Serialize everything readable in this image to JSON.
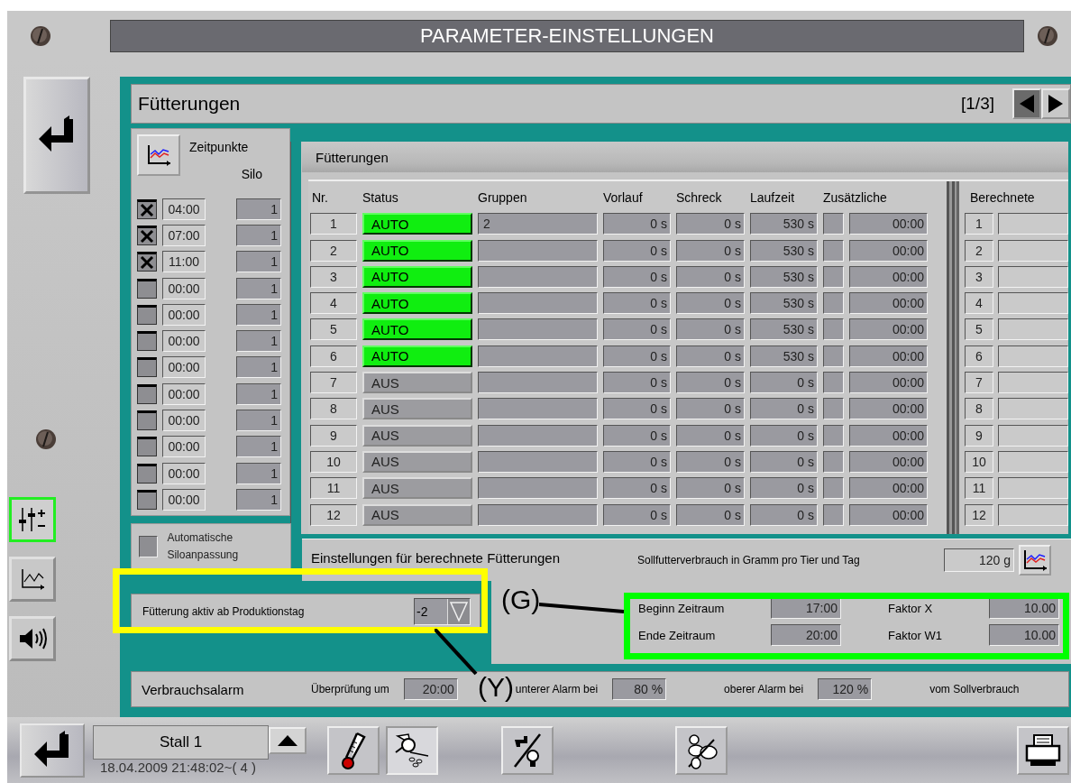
{
  "window": {
    "title": "PARAMETER-EINSTELLUNGEN"
  },
  "page": {
    "title": "Fütterungen",
    "pager": "[1/3]"
  },
  "sidebar": [
    {
      "kind": "settings",
      "selected": true
    },
    {
      "kind": "chart",
      "selected": false
    },
    {
      "kind": "sound",
      "selected": false
    }
  ],
  "zeitpunkte": {
    "label": "Zeitpunkte",
    "silo_label": "Silo",
    "rows": [
      {
        "time": "04:00",
        "silo": "1",
        "checked": true
      },
      {
        "time": "07:00",
        "silo": "1",
        "checked": true
      },
      {
        "time": "11:00",
        "silo": "1",
        "checked": true
      },
      {
        "time": "00:00",
        "silo": "1",
        "checked": false
      },
      {
        "time": "00:00",
        "silo": "1",
        "checked": false
      },
      {
        "time": "00:00",
        "silo": "1",
        "checked": false
      },
      {
        "time": "00:00",
        "silo": "1",
        "checked": false
      },
      {
        "time": "00:00",
        "silo": "1",
        "checked": false
      },
      {
        "time": "00:00",
        "silo": "1",
        "checked": false
      },
      {
        "time": "00:00",
        "silo": "1",
        "checked": false
      },
      {
        "time": "00:00",
        "silo": "1",
        "checked": false
      },
      {
        "time": "00:00",
        "silo": "1",
        "checked": false
      }
    ]
  },
  "auto_silo": {
    "label": "Automatische Siloanpassung",
    "checked": false
  },
  "feedings": {
    "title": "Fütterungen",
    "columns": [
      "Nr.",
      "Status",
      "Gruppen",
      "Vorlauf",
      "Schreck",
      "Laufzeit",
      "Zusätzliche"
    ],
    "rows": [
      {
        "nr": "1",
        "status": "AUTO",
        "on": true,
        "gruppen": "2",
        "vorlauf": "0 s",
        "schreck": "0 s",
        "laufzeit": "530 s",
        "extra_checked": false,
        "extra_time": "00:00"
      },
      {
        "nr": "2",
        "status": "AUTO",
        "on": true,
        "gruppen": "",
        "vorlauf": "0 s",
        "schreck": "0 s",
        "laufzeit": "530 s",
        "extra_checked": false,
        "extra_time": "00:00"
      },
      {
        "nr": "3",
        "status": "AUTO",
        "on": true,
        "gruppen": "",
        "vorlauf": "0 s",
        "schreck": "0 s",
        "laufzeit": "530 s",
        "extra_checked": false,
        "extra_time": "00:00"
      },
      {
        "nr": "4",
        "status": "AUTO",
        "on": true,
        "gruppen": "",
        "vorlauf": "0 s",
        "schreck": "0 s",
        "laufzeit": "530 s",
        "extra_checked": false,
        "extra_time": "00:00"
      },
      {
        "nr": "5",
        "status": "AUTO",
        "on": true,
        "gruppen": "",
        "vorlauf": "0 s",
        "schreck": "0 s",
        "laufzeit": "530 s",
        "extra_checked": false,
        "extra_time": "00:00"
      },
      {
        "nr": "6",
        "status": "AUTO",
        "on": true,
        "gruppen": "",
        "vorlauf": "0 s",
        "schreck": "0 s",
        "laufzeit": "530 s",
        "extra_checked": false,
        "extra_time": "00:00"
      },
      {
        "nr": "7",
        "status": "AUS",
        "on": false,
        "gruppen": "",
        "vorlauf": "0 s",
        "schreck": "0 s",
        "laufzeit": "0 s",
        "extra_checked": false,
        "extra_time": "00:00"
      },
      {
        "nr": "8",
        "status": "AUS",
        "on": false,
        "gruppen": "",
        "vorlauf": "0 s",
        "schreck": "0 s",
        "laufzeit": "0 s",
        "extra_checked": false,
        "extra_time": "00:00"
      },
      {
        "nr": "9",
        "status": "AUS",
        "on": false,
        "gruppen": "",
        "vorlauf": "0 s",
        "schreck": "0 s",
        "laufzeit": "0 s",
        "extra_checked": false,
        "extra_time": "00:00"
      },
      {
        "nr": "10",
        "status": "AUS",
        "on": false,
        "gruppen": "",
        "vorlauf": "0 s",
        "schreck": "0 s",
        "laufzeit": "0 s",
        "extra_checked": false,
        "extra_time": "00:00"
      },
      {
        "nr": "11",
        "status": "AUS",
        "on": false,
        "gruppen": "",
        "vorlauf": "0 s",
        "schreck": "0 s",
        "laufzeit": "0 s",
        "extra_checked": false,
        "extra_time": "00:00"
      },
      {
        "nr": "12",
        "status": "AUS",
        "on": false,
        "gruppen": "",
        "vorlauf": "0 s",
        "schreck": "0 s",
        "laufzeit": "0 s",
        "extra_checked": false,
        "extra_time": "00:00"
      }
    ]
  },
  "berechnete": {
    "title": "Berechnete",
    "rows": [
      "1",
      "2",
      "3",
      "4",
      "5",
      "6",
      "7",
      "8",
      "9",
      "10",
      "11",
      "12"
    ]
  },
  "production_day": {
    "label": "Fütterung aktiv ab Produktionstag",
    "value": "-2"
  },
  "calculated_settings": {
    "title": "Einstellungen für berechnete Fütterungen",
    "target_label": "Sollfutterverbrauch in Gramm pro Tier und Tag",
    "target_value": "120 g",
    "fields": [
      {
        "label": "Beginn Zeitraum",
        "value": "17:00"
      },
      {
        "label": "Faktor X",
        "value": "10.00"
      },
      {
        "label": "Ende Zeitraum",
        "value": "20:00"
      },
      {
        "label": "Faktor W1",
        "value": "10.00"
      }
    ]
  },
  "alarm": {
    "title": "Verbrauchsalarm",
    "items": [
      {
        "label": "Überprüfung um",
        "value": "20:00"
      },
      {
        "label": "unterer Alarm bei",
        "value": "80 %"
      },
      {
        "label": "oberer Alarm bei",
        "value": "120 %"
      }
    ],
    "suffix": "vom Sollverbrauch"
  },
  "annotations": [
    {
      "label": "(Y)"
    },
    {
      "label": "(G)"
    }
  ],
  "footer": {
    "stall": "Stall 1",
    "timestamp": "18.04.2009 21:48:02~( 4 )",
    "tools": [
      {
        "kind": "thermometer",
        "selected": false
      },
      {
        "kind": "feeder",
        "selected": true
      },
      {
        "kind": "water-light",
        "selected": false
      },
      {
        "kind": "animals",
        "selected": false
      },
      {
        "kind": "printer",
        "selected": false
      }
    ]
  }
}
